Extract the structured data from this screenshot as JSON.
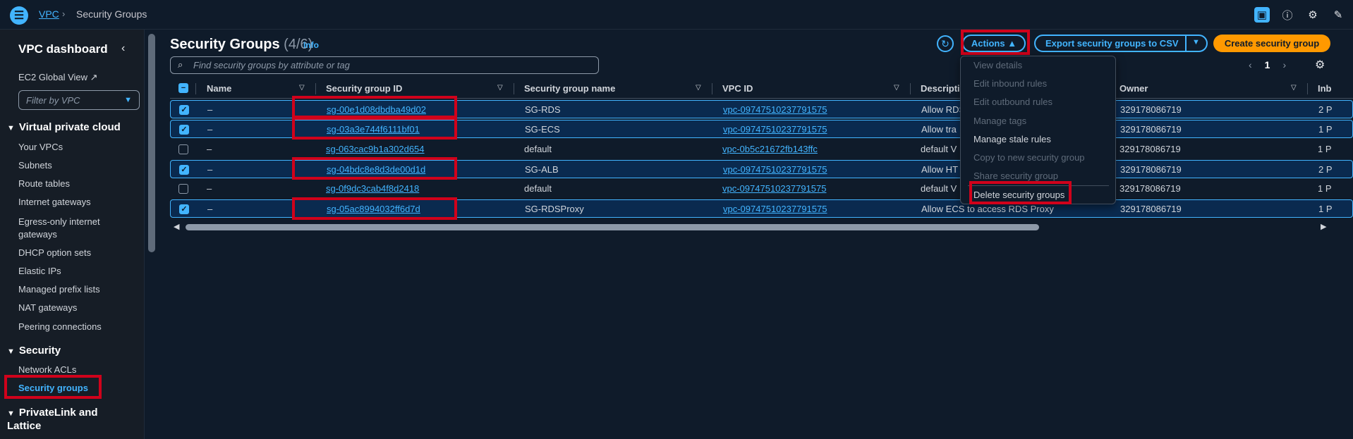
{
  "topbar": {
    "breadcrumb_root": "VPC",
    "breadcrumb_sep": "›",
    "breadcrumb_current": "Security Groups"
  },
  "sidebar": {
    "title": "VPC dashboard",
    "collapse_glyph": "‹",
    "ec2_global_view": "EC2 Global View",
    "filter_placeholder": "Filter by VPC",
    "sections": {
      "vpc": "Virtual private cloud",
      "security": "Security",
      "privatelink": "PrivateLink and Lattice"
    },
    "vpc_items": [
      "Your VPCs",
      "Subnets",
      "Route tables",
      "Internet gateways",
      "Egress-only internet gateways",
      "DHCP option sets",
      "Elastic IPs",
      "Managed prefix lists",
      "NAT gateways",
      "Peering connections"
    ],
    "security_items": [
      "Network ACLs",
      "Security groups"
    ]
  },
  "header": {
    "title": "Security Groups",
    "count": "(4/6)",
    "info": "Info",
    "actions_label": "Actions ▲",
    "export_label": "Export security groups to CSV",
    "create_label": "Create security group"
  },
  "search": {
    "placeholder": "Find security groups by attribute or tag"
  },
  "pager": {
    "prev": "‹",
    "page": "1",
    "next": "›"
  },
  "table": {
    "columns": [
      "Name",
      "Security group ID",
      "Security group name",
      "VPC ID",
      "Description",
      "Owner",
      "Inb"
    ],
    "rows": [
      {
        "selected": true,
        "name": "–",
        "id": "sg-00e1d08dbdba49d02",
        "sgname": "SG-RDS",
        "vpc": "vpc-09747510237791575",
        "desc": "Allow RDS",
        "owner": "329178086719",
        "inb": "2 P"
      },
      {
        "selected": true,
        "name": "–",
        "id": "sg-03a3e744f6111bf01",
        "sgname": "SG-ECS",
        "vpc": "vpc-09747510237791575",
        "desc": "Allow tra",
        "owner": "329178086719",
        "inb": "1 P"
      },
      {
        "selected": false,
        "name": "–",
        "id": "sg-063cac9b1a302d654",
        "sgname": "default",
        "vpc": "vpc-0b5c21672fb143ffc",
        "desc": "default V",
        "owner": "329178086719",
        "inb": "1 P"
      },
      {
        "selected": true,
        "name": "–",
        "id": "sg-04bdc8e8d3de00d1d",
        "sgname": "SG-ALB",
        "vpc": "vpc-09747510237791575",
        "desc": "Allow HT",
        "owner": "329178086719",
        "inb": "2 P"
      },
      {
        "selected": false,
        "name": "–",
        "id": "sg-0f9dc3cab4f8d2418",
        "sgname": "default",
        "vpc": "vpc-09747510237791575",
        "desc": "default V",
        "owner": "329178086719",
        "inb": "1 P"
      },
      {
        "selected": true,
        "name": "–",
        "id": "sg-05ac8994032ff6d7d",
        "sgname": "SG-RDSProxy",
        "vpc": "vpc-09747510237791575",
        "desc": "Allow ECS to access RDS Proxy",
        "owner": "329178086719",
        "inb": "1 P"
      }
    ]
  },
  "actions_menu": {
    "items": [
      {
        "label": "View details",
        "enabled": false
      },
      {
        "label": "Edit inbound rules",
        "enabled": false
      },
      {
        "label": "Edit outbound rules",
        "enabled": false
      },
      {
        "label": "Manage tags",
        "enabled": false
      },
      {
        "label": "Manage stale rules",
        "enabled": true
      },
      {
        "label": "Copy to new security group",
        "enabled": false
      },
      {
        "label": "Share security group",
        "enabled": false
      },
      {
        "label": "Delete security groups",
        "enabled": true
      }
    ]
  },
  "colors": {
    "accent": "#42b4ff",
    "primary_button": "#ff9900",
    "highlight": "#d0021b",
    "background": "#0f1b2a"
  }
}
